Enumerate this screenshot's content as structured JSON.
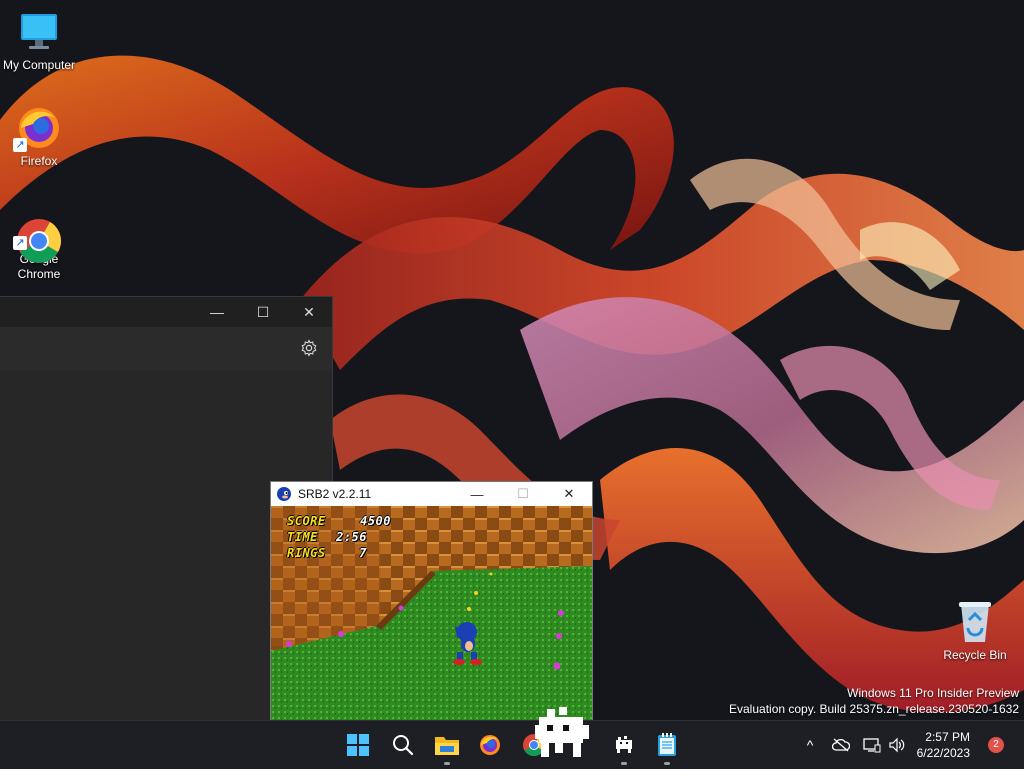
{
  "desktop": {
    "icons": [
      {
        "label": "My Computer"
      },
      {
        "label": "Firefox"
      },
      {
        "label": "Google\nChrome"
      },
      {
        "label": "Recycle Bin"
      }
    ],
    "watermark": {
      "line1": "Windows 11 Pro Insider Preview",
      "line2": "Evaluation copy. Build 25375.zn_release.230520-1632"
    }
  },
  "dark_window": {
    "minimize_glyph": "—",
    "maximize_glyph": "☐",
    "close_glyph": "✕"
  },
  "srb2_window": {
    "title": "SRB2 v2.2.11",
    "minimize_glyph": "—",
    "maximize_glyph": "☐",
    "close_glyph": "✕",
    "hud": {
      "score_label": "SCORE",
      "score_value": "4500",
      "time_label": "TIME",
      "time_value": "2:56",
      "rings_label": "RINGS",
      "rings_value": "7"
    }
  },
  "taskbar": {
    "apps": [
      "start-icon",
      "search-icon",
      "file-explorer-icon",
      "firefox-icon",
      "chrome-icon",
      "srb2-mascot-icon",
      "app-dog-icon",
      "notepad-icon"
    ],
    "tray_overflow_glyph": "^",
    "clock_time": "2:57 PM",
    "clock_date": "6/22/2023",
    "notification_count": "2"
  },
  "colors": {
    "taskbar": "#1e1f24",
    "wallpaper_base": "#15161c",
    "hud_yellow": "#f6e120",
    "notification": "#e0524a"
  }
}
